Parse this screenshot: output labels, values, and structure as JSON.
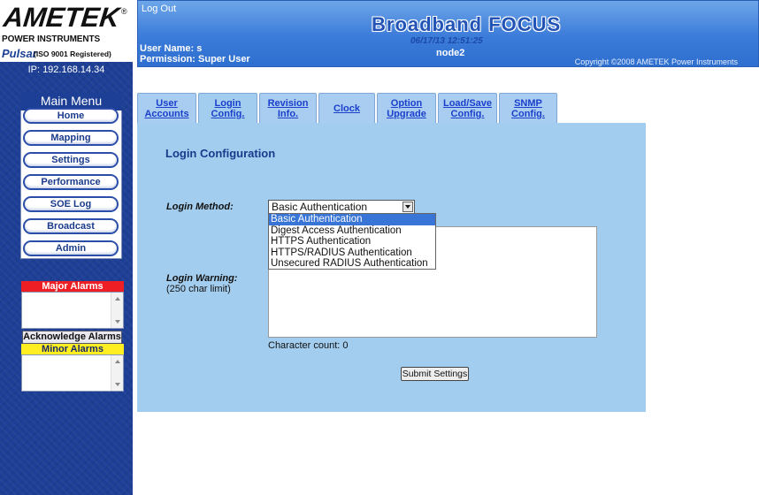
{
  "logo": {
    "brand": "AMETEK",
    "registered": "®",
    "division": "POWER INSTRUMENTS",
    "product": "Pulsar",
    "iso": "(ISO 9001 Registered)"
  },
  "ip": "IP: 192.168.14.34",
  "header": {
    "logout_label": "Log Out",
    "user_name": "User Name: s",
    "permission": "Permission: Super User",
    "app_title": "Broadband FOCUS",
    "datetime": "06/17/13 12:51:25",
    "node": "node2",
    "copyright": "Copyright ©2008 AMETEK Power Instruments"
  },
  "menu": {
    "title": "Main Menu",
    "items": [
      {
        "label": "Home"
      },
      {
        "label": "Mapping"
      },
      {
        "label": "Settings"
      },
      {
        "label": "Performance"
      },
      {
        "label": "SOE Log"
      },
      {
        "label": "Broadcast"
      },
      {
        "label": "Admin"
      }
    ]
  },
  "alarms": {
    "major_title": "Major Alarms",
    "acknowledge_label": "Acknowledge Alarms",
    "minor_title": "Minor Alarms",
    "colors": {
      "major": "#ee1f24",
      "minor": "#ffee22"
    }
  },
  "tabs": [
    {
      "line1": "User",
      "line2": "Accounts"
    },
    {
      "line1": "Login",
      "line2": "Config.",
      "active": true
    },
    {
      "line1": "Revision",
      "line2": "Info."
    },
    {
      "line1": "Clock",
      "line2": ""
    },
    {
      "line1": "Option",
      "line2": "Upgrade"
    },
    {
      "line1": "Load/Save",
      "line2": "Config."
    },
    {
      "line1": "SNMP",
      "line2": "Config."
    }
  ],
  "login": {
    "title": "Login Configuration",
    "method_label": "Login Method:",
    "method_value": "Basic Authentication",
    "options": [
      "Basic Authentication",
      "Digest Access Authentication",
      "HTTPS Authentication",
      "HTTPS/RADIUS Authentication",
      "Unsecured RADIUS Authentication"
    ],
    "warning_label": "Login Warning:",
    "warning_limit": "(250 char limit)",
    "warning_value": "",
    "char_count": "Character count: 0",
    "submit_label": "Submit Settings"
  }
}
